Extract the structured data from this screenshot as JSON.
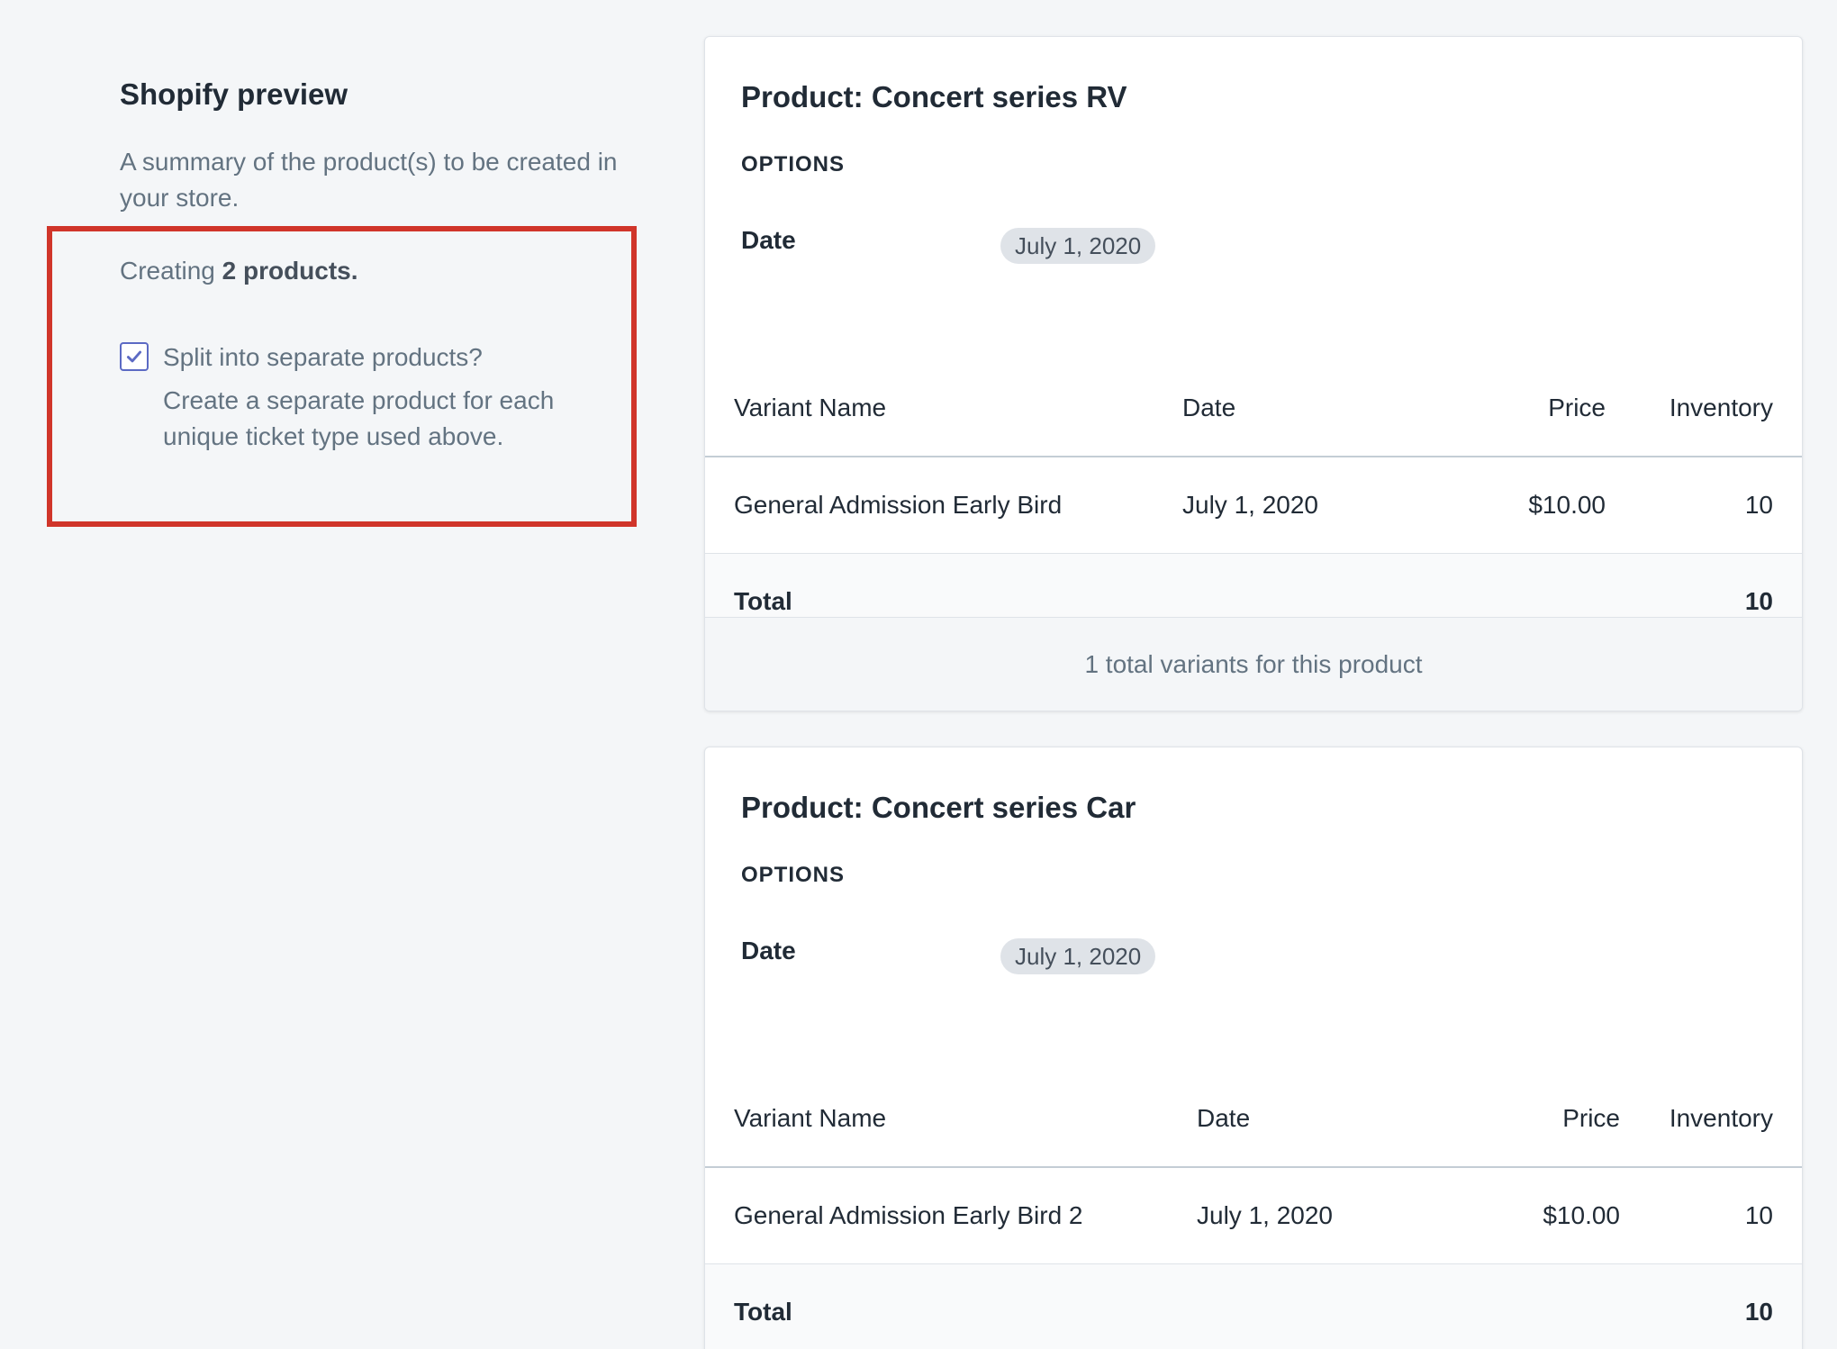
{
  "preview": {
    "title": "Shopify preview",
    "description": "A summary of the product(s) to be created in your store.",
    "creating_prefix": "Creating",
    "creating_count": "2 products.",
    "split": {
      "checked": true,
      "label": "Split into separate products?",
      "help": "Create a separate product for each unique ticket type used above."
    },
    "highlight_color": "#d0352a"
  },
  "products": [
    {
      "title": "Product: Concert series RV",
      "options_heading": "OPTIONS",
      "option_name": "Date",
      "option_value": "July 1, 2020",
      "columns": [
        "Variant Name",
        "Date",
        "Price",
        "Inventory"
      ],
      "rows": [
        {
          "name": "General Admission Early Bird",
          "date": "July 1, 2020",
          "price": "$10.00",
          "inventory": "10"
        }
      ],
      "total_label": "Total",
      "total_value": "10",
      "footer": "1 total variants for this product"
    },
    {
      "title": "Product: Concert series Car",
      "options_heading": "OPTIONS",
      "option_name": "Date",
      "option_value": "July 1, 2020",
      "columns": [
        "Variant Name",
        "Date",
        "Price",
        "Inventory"
      ],
      "rows": [
        {
          "name": "General Admission Early Bird 2",
          "date": "July 1, 2020",
          "price": "$10.00",
          "inventory": "10"
        }
      ],
      "total_label": "Total",
      "total_value": "10"
    }
  ],
  "colors": {
    "checkbox_accent": "#5c6ac4",
    "background": "#f4f6f8",
    "text_primary": "#212b36",
    "text_subdued": "#637381"
  }
}
